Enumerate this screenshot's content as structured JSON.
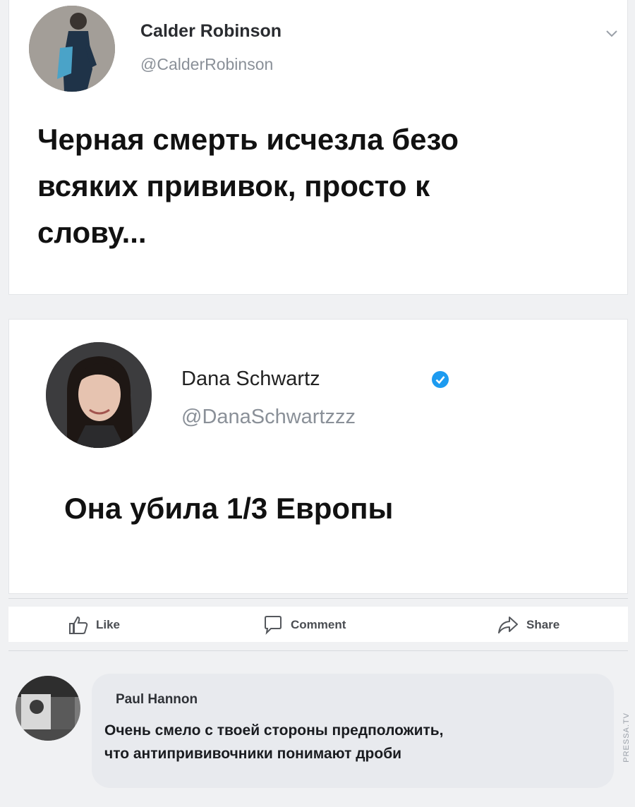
{
  "tweet1": {
    "name": "Calder Robinson",
    "handle": "@CalderRobinson",
    "text_line1": "Черная смерть исчезла безо",
    "text_line2": "всяких прививок, просто к",
    "text_line3": "слову..."
  },
  "tweet2": {
    "name": "Dana Schwartz",
    "handle": "@DanaSchwartzzz",
    "text": "Она убила 1/3 Европы"
  },
  "actions": {
    "like_label": "Like",
    "comment_label": "Comment",
    "share_label": "Share"
  },
  "comment": {
    "author": "Paul Hannon",
    "line1": "Очень смело с твоей стороны предположить,",
    "line2": "что антипрививочники понимают дроби"
  },
  "watermark": "PRESSA.TV",
  "colors": {
    "verified_blue": "#1d9bf0",
    "bubble_bg": "#e8eaee",
    "page_bg": "#f0f1f3"
  }
}
